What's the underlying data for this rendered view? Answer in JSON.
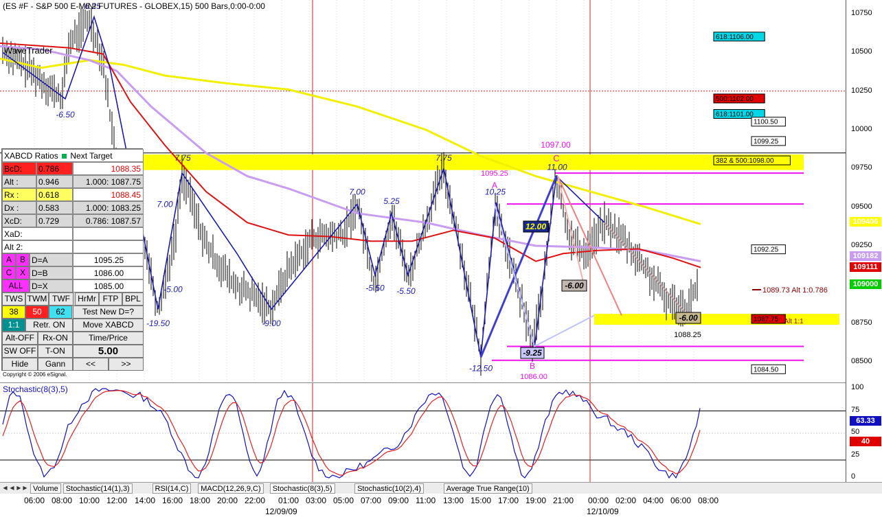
{
  "chart": {
    "title": "(ES #F - S&P 500 E-MINI FUTURES - GLOBEX,15) 500 Bars,0:00-0:00",
    "copyright": "Copyright © 2006 eSignal.",
    "overlay_label": "WaveTrader",
    "price_axis": [
      "10750",
      "10500",
      "10250",
      "10000",
      "09750",
      "09500",
      "09250",
      "09000",
      "08750",
      "08500"
    ],
    "price_badges": [
      {
        "text": "109406",
        "bg": "#ffff00",
        "fg": "#ffffff",
        "value": 1094.06
      },
      {
        "text": "109182",
        "bg": "#c89cf0",
        "fg": "#ffffff",
        "value": 1091.82
      },
      {
        "text": "109111",
        "bg": "#e00000",
        "fg": "#ffffff",
        "value": 1091.11
      },
      {
        "text": "109000",
        "bg": "#00cc00",
        "fg": "#ffffff",
        "value": 1090.0
      }
    ]
  },
  "levels": [
    {
      "text": "618:1106.00",
      "bg": "#00d8e8",
      "value": 1106.0
    },
    {
      "text": "500:1102.00",
      "bg": "#e00000",
      "value": 1102.0
    },
    {
      "text": "618:1101.00",
      "bg": "#00d8e8",
      "value": 1101.0
    },
    {
      "text": "1100.50",
      "bg": "#ffffff",
      "value": 1100.5
    },
    {
      "text": "1099.25",
      "bg": "#ffffff",
      "value": 1099.25
    },
    {
      "text": "382 & 500:1098.00",
      "bg": "#ffff00",
      "value": 1098.0
    },
    {
      "text": "1092.25",
      "bg": "#ffffff",
      "value": 1092.25
    },
    {
      "text": "1087.75",
      "bg": "#e00000",
      "value": 1087.75
    },
    {
      "text": "1084.50",
      "bg": "#ffffff",
      "value": 1084.5
    }
  ],
  "annotations": {
    "alt_note": "1089.73 Alt 1:0.786",
    "alt_note2": "75 Alt 1:1",
    "c_price": "1097.00",
    "c_letter": "C",
    "a_price": "1095.25",
    "a_letter": "A",
    "b_letter": "B",
    "b_price": "1086.00",
    "d_price": "1088.25",
    "d_box": "-6.00",
    "box_12": "12.00",
    "box_m6": "-6.00",
    "box_m925": "-9.25",
    "swing_labels": [
      "6.25",
      "-6.50",
      "7.75",
      "7.00",
      "-5.00",
      "-19.50",
      "-9.00",
      "7.00",
      "5.25",
      "-5.50",
      "-5.50",
      "7.75",
      "10.25",
      "-12.50",
      "11.00"
    ]
  },
  "panel": {
    "header": "XABCD Ratios",
    "header_target": "Next Target",
    "rows": [
      {
        "label": "BcD:",
        "ratio": "0.786",
        "target": "1088.35",
        "lbg": "#ff2020",
        "tbg": "#ffffff",
        "tfg": "#e00000"
      },
      {
        "label": "Alt  :",
        "ratio": "0.946",
        "target": "1.000: 1087.75",
        "lbg": "#d9d9d9",
        "tbg": "#d9d9d9",
        "tfg": "#000000"
      },
      {
        "label": "Rx   :",
        "ratio": "0.618",
        "target": "1088.45",
        "lbg": "#ffff60",
        "tbg": "#ffffff",
        "tfg": "#e00000"
      },
      {
        "label": "Dx   :",
        "ratio": "0.583",
        "target": "1.000: 1083.25",
        "lbg": "#d9d9d9",
        "tbg": "#d9d9d9",
        "tfg": "#000000"
      },
      {
        "label": "XcD:",
        "ratio": "0.729",
        "target": "0.786: 1087.57",
        "lbg": "#d9d9d9",
        "tbg": "#d9d9d9",
        "tfg": "#000000"
      }
    ],
    "xad": "XaD:",
    "alt2": "Alt 2:",
    "d_rows": [
      {
        "k1": "A",
        "k2": "B",
        "eq": "D=A",
        "val": "1095.25"
      },
      {
        "k1": "C",
        "k2": "X",
        "eq": "D=B",
        "val": "1086.00"
      },
      {
        "k1": "ALL",
        "k2": "",
        "eq": "D=X",
        "val": "1085.00"
      }
    ],
    "tabs": [
      "TWS",
      "TWM",
      "TWF",
      "HrMr",
      "FTP",
      "BPL"
    ],
    "values": [
      "38",
      "50",
      "62"
    ],
    "test_new": "Test New D=?",
    "ratio_btn": "1:1",
    "retr": "Retr. ON",
    "move": "Move XABCD",
    "alt_off": "Alt-OFF",
    "rx_on": "Rx-ON",
    "time_price": "Time/Price",
    "sw_off": "SW OFF",
    "t_on": "T-ON",
    "step": "5.00",
    "hide": "Hide",
    "gann": "Gann",
    "prev": "<<",
    "next": ">>"
  },
  "stochastic": {
    "title": "Stochastic(8(3),5)",
    "axis": [
      "100",
      "75",
      "50",
      "25",
      "0"
    ],
    "badges": [
      {
        "text": "63.33",
        "bg": "#1010c0",
        "value": 63.33
      },
      {
        "text": "40",
        "bg": "#e00000",
        "value": 40
      }
    ]
  },
  "study_tabs": [
    "Volume",
    "Stochastic(14(1),3)",
    "RSI(14,C)",
    "MACD(12,26,9,C)",
    "Stochastic(8(3),5)",
    "Stochastic(10(2),4)",
    "Average True Range(10)"
  ],
  "active_study_tab": 4,
  "time_axis": [
    "06:00",
    "08:00",
    "10:00",
    "12:00",
    "14:00",
    "16:00",
    "18:00",
    "20:00",
    "22:00",
    "01:00",
    "03:00",
    "05:00",
    "07:00",
    "09:00",
    "11:00",
    "13:00",
    "15:00",
    "17:00",
    "19:00",
    "21:00",
    "00:00",
    "02:00",
    "04:00",
    "06:00",
    "08:00"
  ],
  "dates": [
    "12/09/09",
    "12/10/09"
  ],
  "colors": {
    "price_line": "#000000",
    "pattern": "#1a1ab0",
    "ma_red": "#dd1111",
    "ma_purple": "#c89cf0",
    "ma_yellow": "#f0f000",
    "magenta": "#ee10ee",
    "stoch_k": "#1010c0",
    "stoch_d": "#e02020"
  },
  "icons": [
    "scroll-left-icon",
    "scroll-right-icon",
    "scroll-first-icon",
    "scroll-last-icon"
  ]
}
